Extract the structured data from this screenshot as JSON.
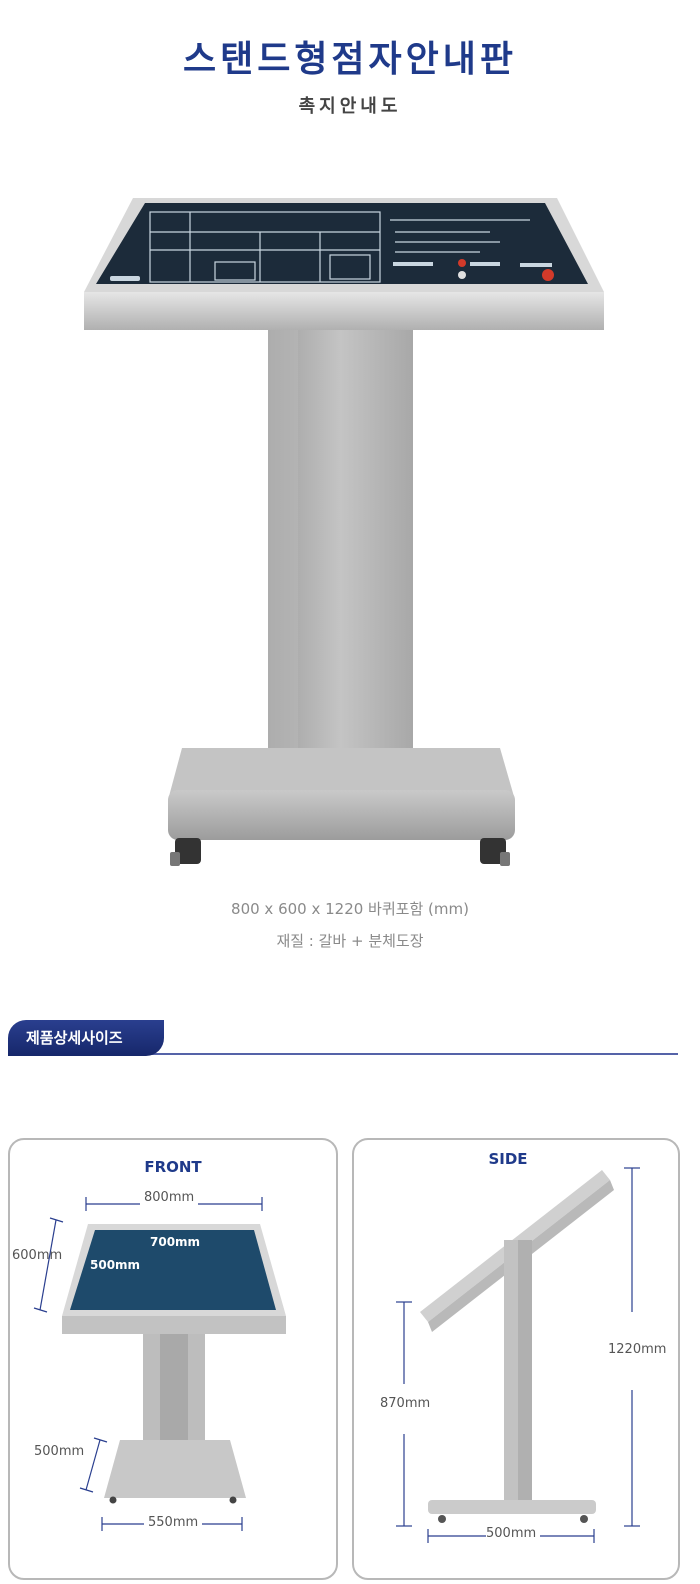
{
  "header": {
    "title": "스탠드형점자안내판",
    "subtitle": "촉지안내도"
  },
  "product": {
    "size_text": "800 x 600 x 1220 바퀴포함 (mm)",
    "material_text": "재질 :  갈바 + 분체도장"
  },
  "section": {
    "title": "제품상세사이즈"
  },
  "front": {
    "label": "FRONT",
    "width_top": "800mm",
    "depth_top": "600mm",
    "inner_width": "700mm",
    "inner_height": "500mm",
    "base_depth": "500mm",
    "base_width": "550mm"
  },
  "side": {
    "label": "SIDE",
    "total_height": "1220mm",
    "top_height": "870mm",
    "base_width": "500mm"
  },
  "colors": {
    "title": "#1f3a8a",
    "board": "#1c2b3a",
    "inner_panel": "#1e4a6b",
    "stand_gray": "#b5b5b5",
    "dim_line": "#2a3f8f"
  }
}
